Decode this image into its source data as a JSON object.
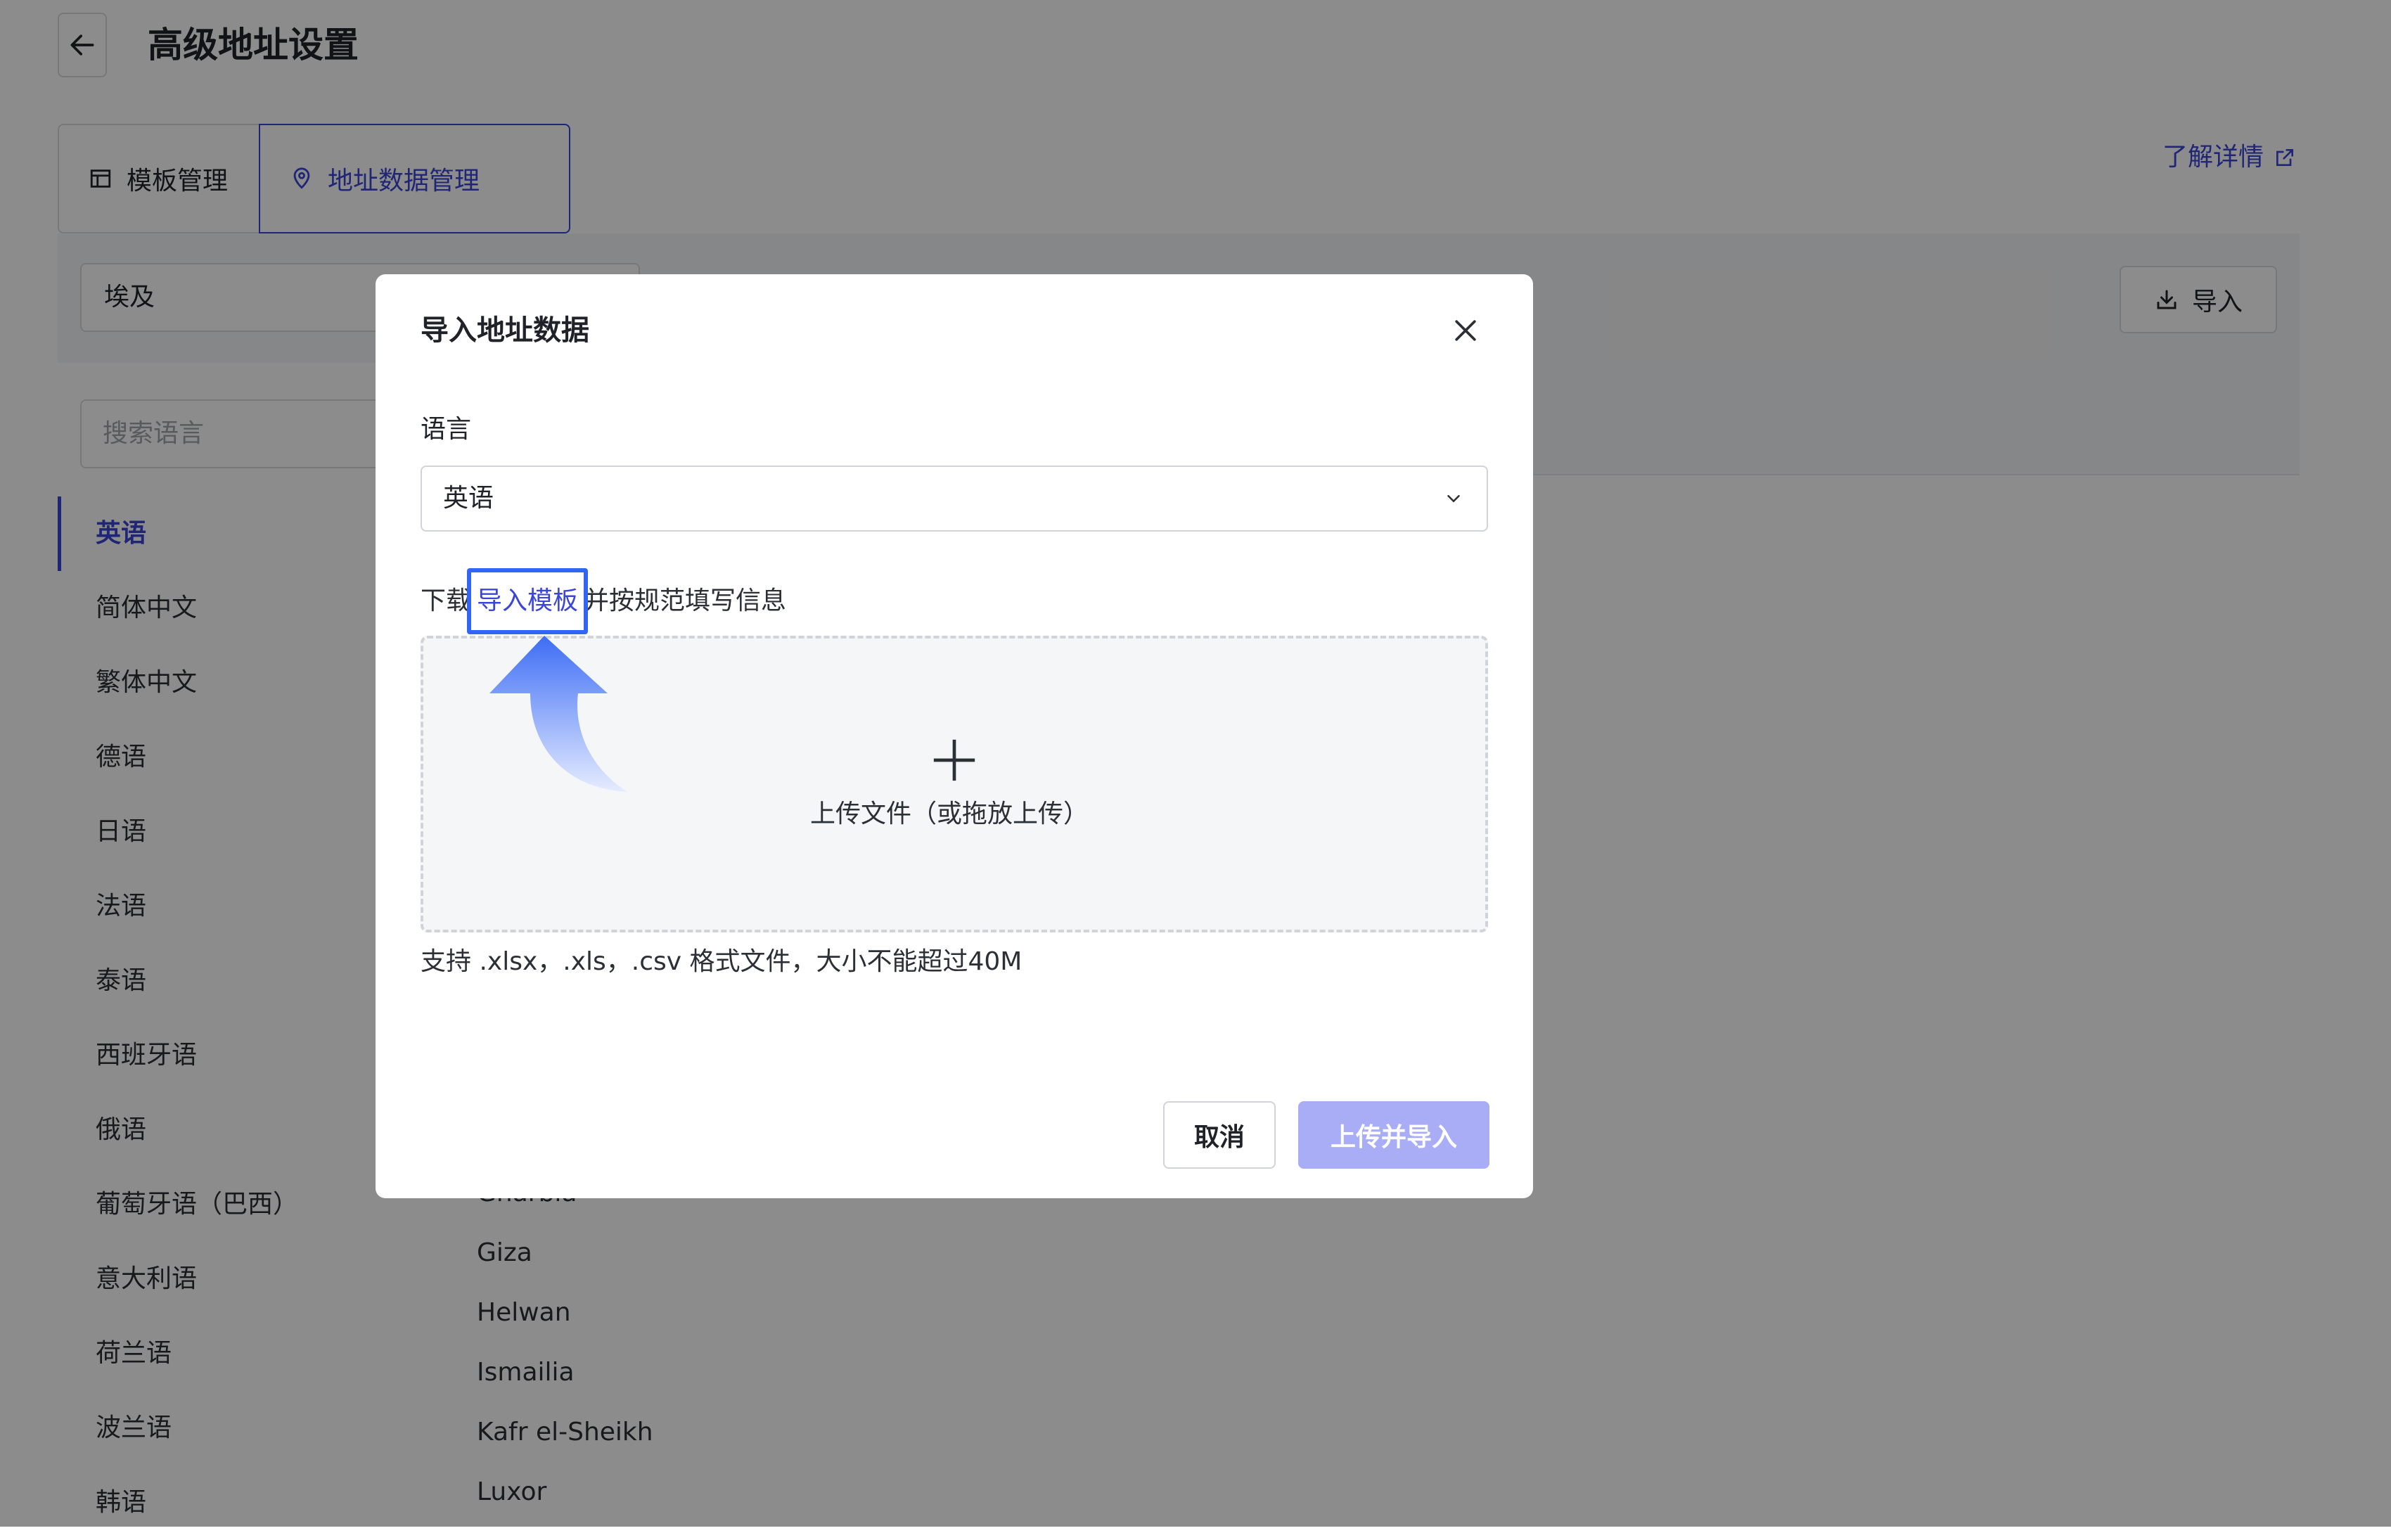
{
  "page": {
    "title": "高级地址设置",
    "tabs": [
      {
        "label": "模板管理",
        "icon": "template-icon"
      },
      {
        "label": "地址数据管理",
        "icon": "location-pin-icon"
      }
    ],
    "learn_more": "了解详情",
    "country": "埃及",
    "import_label": "导入",
    "search_placeholder": "搜索语言",
    "languages": [
      "英语",
      "简体中文",
      "繁体中文",
      "德语",
      "日语",
      "法语",
      "泰语",
      "西班牙语",
      "俄语",
      "葡萄牙语（巴西）",
      "意大利语",
      "荷兰语",
      "波兰语",
      "韩语"
    ],
    "regions": [
      "Gharbia",
      "Giza",
      "Helwan",
      "Ismailia",
      "Kafr el-Sheikh",
      "Luxor"
    ]
  },
  "modal": {
    "title": "导入地址数据",
    "language_label": "语言",
    "language_value": "英语",
    "download_prefix": "下载",
    "download_link": "导入模板",
    "download_suffix": "并按规范填写信息",
    "upload_text": "上传文件（或拖放上传）",
    "support_text": "支持 .xlsx，.xls，.csv 格式文件，大小不能超过40M",
    "cancel_label": "取消",
    "submit_label": "上传并导入"
  },
  "colors": {
    "accent": "#3b45d6",
    "submit_disabled": "#a8adf5",
    "highlight": "#3365f2",
    "mask": "rgba(0,0,0,0.45)"
  }
}
